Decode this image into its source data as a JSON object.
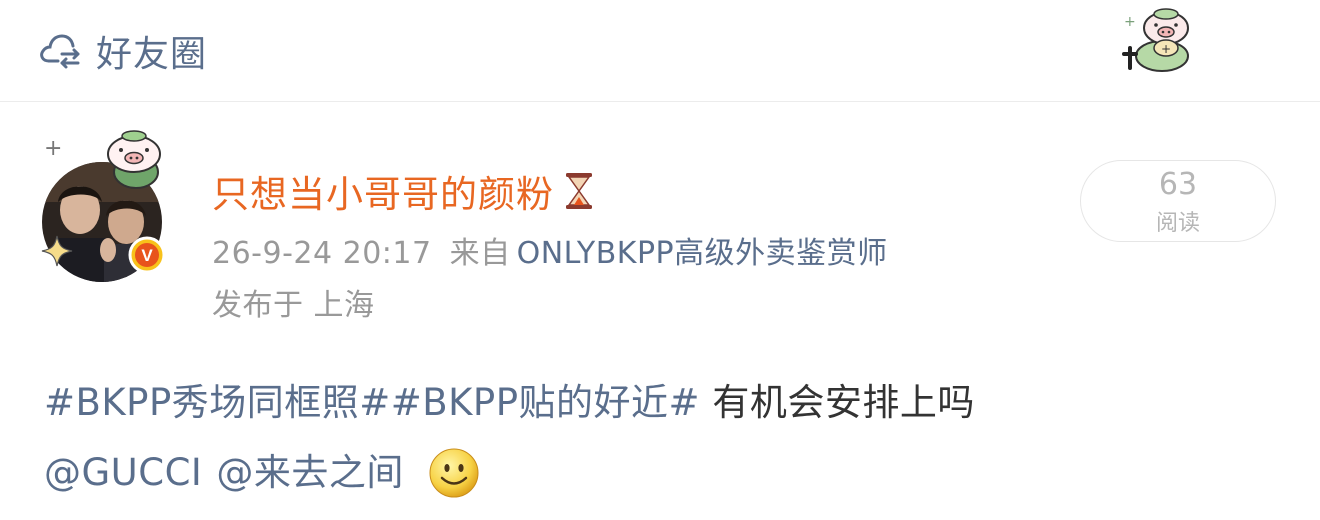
{
  "header": {
    "visibility_label": "好友圈",
    "visibility_icon": "cloud-friends-icon",
    "sticker": "piglet-sticker"
  },
  "post": {
    "author": {
      "name": "只想当小哥哥的颜粉",
      "badge_icon": "hourglass-icon",
      "avatar_badge": "V"
    },
    "timestamp": "26-9-24 20:17",
    "source_prefix": "来自",
    "source": "ONLYBKPP高级外卖鉴赏师",
    "location": "发布于 上海",
    "reads": {
      "count": "63",
      "label": "阅读"
    },
    "content": {
      "topic1": "#BKPP秀场同框照#",
      "topic2": "#BKPP贴的好近#",
      "text": " 有机会安排上吗",
      "mention1": "@GUCCI",
      "mention2": "@来去之间",
      "emoji": "smile-emoji"
    }
  },
  "colors": {
    "username": "#e86722",
    "link": "#5a6e8c",
    "meta": "#999999",
    "text": "#333333"
  }
}
